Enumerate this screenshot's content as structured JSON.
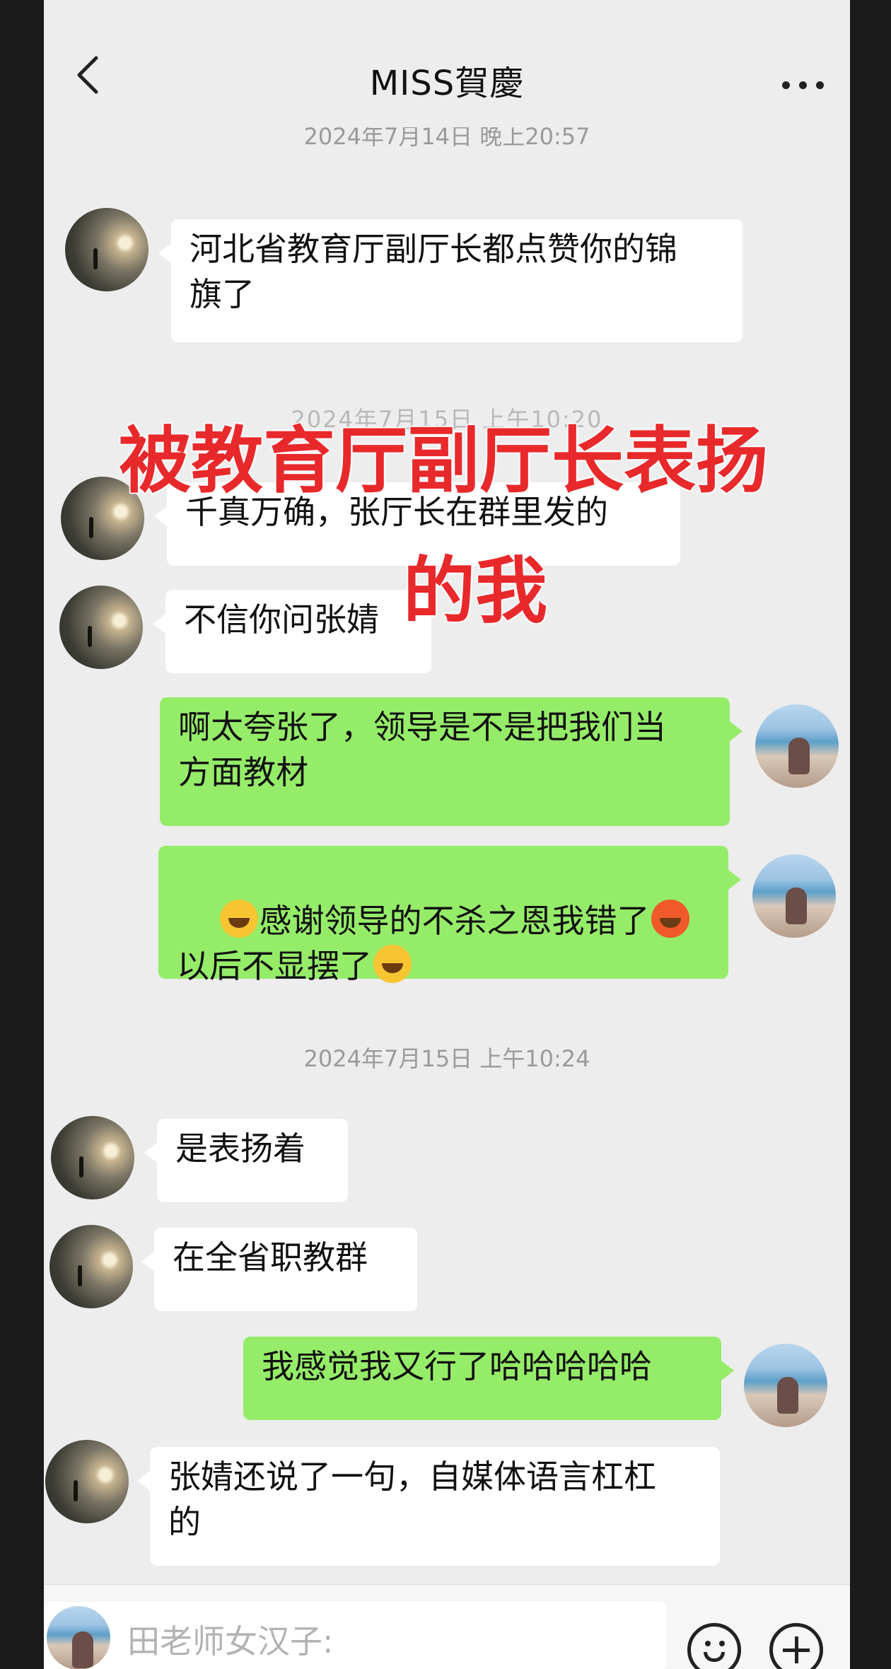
{
  "header": {
    "title": "MISS賀慶",
    "back_icon": "chevron-left-icon",
    "more_icon": "more-dots-icon"
  },
  "timestamps": {
    "first": "2024年7月14日 晚上20:57",
    "ghost": "2024年7月15日 上午10:20",
    "second": "2024年7月15日 上午10:24"
  },
  "messages": [
    {
      "side": "in",
      "text": "河北省教育厅副厅长都点赞你的锦\n旗了"
    },
    {
      "side": "in",
      "text": "千真万确，张厅长在群里发的"
    },
    {
      "side": "in",
      "text": "不信你问张婧"
    },
    {
      "side": "out",
      "text": "啊太夸张了，领导是不是把我们当\n方面教材"
    },
    {
      "side": "out",
      "text_a": "感谢领导的不杀之恩我错了",
      "text_b": "以后不显摆了",
      "emoji_1": "laughing-tears-emoji",
      "emoji_2": "angry-emoji",
      "emoji_3": "crying-emoji"
    },
    {
      "side": "in",
      "text": "是表扬着"
    },
    {
      "side": "in",
      "text": "在全省职教群"
    },
    {
      "side": "out",
      "text": "我感觉我又行了哈哈哈哈哈"
    },
    {
      "side": "in",
      "text": "张婧还说了一句，自媒体语言杠杠\n的"
    }
  ],
  "overlay": {
    "line1": "被教育厅副厅长表扬",
    "line2": "的我",
    "color": "#e8292b"
  },
  "input": {
    "placeholder": "田老师女汉子:",
    "emoji_icon": "smiley-icon",
    "plus_icon": "plus-icon"
  }
}
